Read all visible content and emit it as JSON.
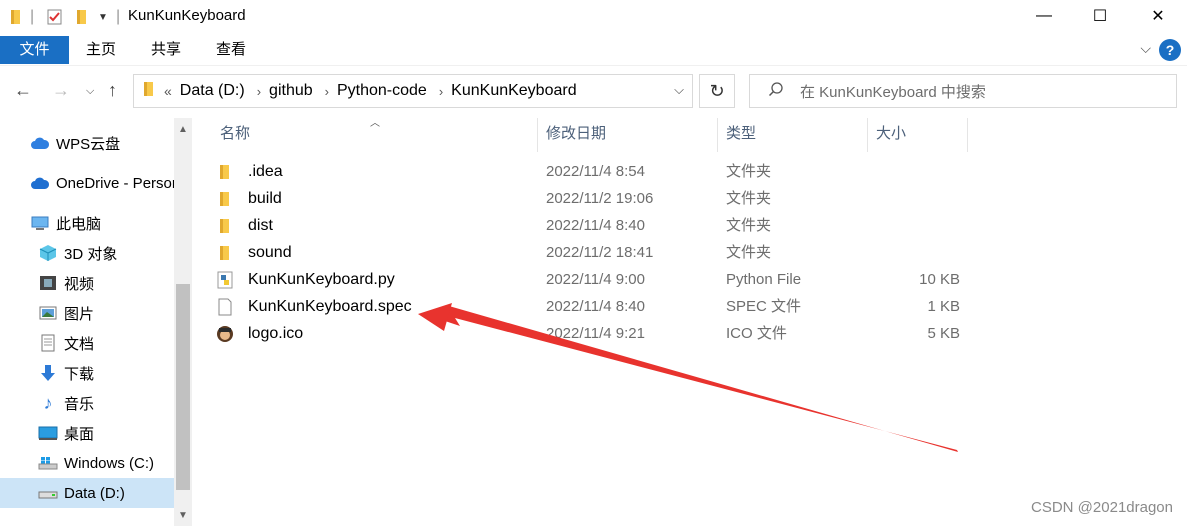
{
  "window": {
    "title": "KunKunKeyboard",
    "minimize": "—",
    "maximize": "☐",
    "close": "✕"
  },
  "ribbon": {
    "tabs": [
      "文件",
      "主页",
      "共享",
      "查看"
    ],
    "help": "?"
  },
  "nav": {
    "breadcrumb_prefix": "«",
    "breadcrumbs": [
      "Data (D:)",
      "github",
      "Python-code",
      "KunKunKeyboard"
    ],
    "search_placeholder": "在 KunKunKeyboard 中搜索"
  },
  "sidebar": {
    "items": [
      {
        "label": "WPS云盘",
        "icon": "cloud-icon"
      },
      {
        "label": "OneDrive - Personal",
        "icon": "onedrive-icon"
      },
      {
        "label": "此电脑",
        "icon": "computer-icon"
      },
      {
        "label": "3D 对象",
        "icon": "cube-3d-icon"
      },
      {
        "label": "视频",
        "icon": "video-icon"
      },
      {
        "label": "图片",
        "icon": "picture-icon"
      },
      {
        "label": "文档",
        "icon": "document-icon"
      },
      {
        "label": "下载",
        "icon": "download-icon"
      },
      {
        "label": "音乐",
        "icon": "music-icon"
      },
      {
        "label": "桌面",
        "icon": "desktop-icon"
      },
      {
        "label": "Windows (C:)",
        "icon": "windows-drive-icon"
      },
      {
        "label": "Data (D:)",
        "icon": "drive-icon",
        "selected": true
      }
    ]
  },
  "columns": {
    "name": "名称",
    "date": "修改日期",
    "type": "类型",
    "size": "大小"
  },
  "files": [
    {
      "name": ".idea",
      "date": "2022/11/4 8:54",
      "type": "文件夹",
      "size": "",
      "icon": "folder-icon"
    },
    {
      "name": "build",
      "date": "2022/11/2 19:06",
      "type": "文件夹",
      "size": "",
      "icon": "folder-icon"
    },
    {
      "name": "dist",
      "date": "2022/11/4 8:40",
      "type": "文件夹",
      "size": "",
      "icon": "folder-icon"
    },
    {
      "name": "sound",
      "date": "2022/11/2 18:41",
      "type": "文件夹",
      "size": "",
      "icon": "folder-icon"
    },
    {
      "name": "KunKunKeyboard.py",
      "date": "2022/11/4 9:00",
      "type": "Python File",
      "size": "10 KB",
      "icon": "python-file-icon"
    },
    {
      "name": "KunKunKeyboard.spec",
      "date": "2022/11/4 8:40",
      "type": "SPEC 文件",
      "size": "1 KB",
      "icon": "blank-file-icon"
    },
    {
      "name": "logo.ico",
      "date": "2022/11/4 9:21",
      "type": "ICO 文件",
      "size": "5 KB",
      "icon": "ico-file-icon"
    }
  ],
  "watermark": "CSDN @2021dragon",
  "colors": {
    "accent": "#1a6fc4",
    "selected": "#cce4f7",
    "folder": "#f8c94a",
    "annotation_arrow": "#e8332e"
  }
}
